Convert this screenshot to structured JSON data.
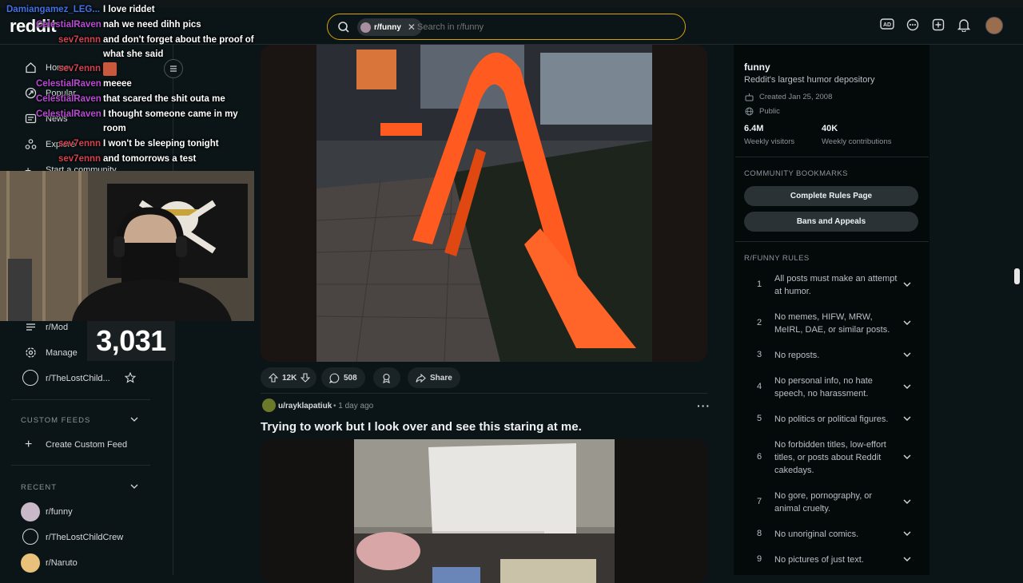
{
  "header": {
    "logo": "reddit",
    "search_chip": "r/funny",
    "search_placeholder": "Search in r/funny"
  },
  "chat": [
    {
      "user": "Damiangamez_LEG...",
      "msg": "I love riddet",
      "color": "dam"
    },
    {
      "user": "CelestialRaven",
      "msg": "nah we need dihh pics",
      "color": "cel"
    },
    {
      "user": "sev7ennn",
      "msg": "and don't forget about the proof of what she said",
      "color": "sev"
    },
    {
      "user": "sev7ennn",
      "msg": "",
      "color": "sev"
    },
    {
      "user": "CelestialRaven",
      "msg": "meeee",
      "color": "cel"
    },
    {
      "user": "CelestialRaven",
      "msg": "that scared the shit outa me",
      "color": "cel"
    },
    {
      "user": "CelestialRaven",
      "msg": "I thought someone came in my room",
      "color": "cel"
    },
    {
      "user": "sev7ennn",
      "msg": "I won't be sleeping tonight",
      "color": "sev"
    },
    {
      "user": "sev7ennn",
      "msg": "and tomorrows a test",
      "color": "sev"
    }
  ],
  "leftnav": {
    "home": "Home",
    "popular": "Popular",
    "news": "News",
    "explore": "Explore",
    "start_community": "Start a community",
    "mod": "r/Mod",
    "manage": "Manage",
    "lostchild": "r/TheLostChild...",
    "custom_feeds": "CUSTOM FEEDS",
    "create_custom_feed": "Create Custom Feed",
    "recent": "RECENT",
    "recent_items": [
      "r/funny",
      "r/TheLostChildCrew",
      "r/Naruto"
    ]
  },
  "counter": "3,031",
  "post1": {
    "upvotes": "12K",
    "comments": "508",
    "share": "Share"
  },
  "post2": {
    "author": "u/rayklapatiuk",
    "time": "• 1 day ago",
    "title": "Trying to work but I look over and see this staring at me."
  },
  "sidebar": {
    "name": "funny",
    "description": "Reddit's largest humor depository",
    "created": "Created Jan 25, 2008",
    "visibility": "Public",
    "visitors_value": "6.4M",
    "visitors_label": "Weekly visitors",
    "contrib_value": "40K",
    "contrib_label": "Weekly contributions",
    "bookmarks_title": "COMMUNITY BOOKMARKS",
    "bookmark1": "Complete Rules Page",
    "bookmark2": "Bans and Appeals",
    "rules_title": "R/FUNNY RULES",
    "rules": [
      {
        "n": "1",
        "text": "All posts must make an attempt at humor."
      },
      {
        "n": "2",
        "text": "No memes, HIFW, MRW, MeIRL, DAE, or similar posts."
      },
      {
        "n": "3",
        "text": "No reposts."
      },
      {
        "n": "4",
        "text": "No personal info, no hate speech, no harassment."
      },
      {
        "n": "5",
        "text": "No politics or political figures."
      },
      {
        "n": "6",
        "text": "No forbidden titles, low-effort titles, or posts about Reddit cakedays."
      },
      {
        "n": "7",
        "text": "No gore, pornography, or animal cruelty."
      },
      {
        "n": "8",
        "text": "No unoriginal comics."
      },
      {
        "n": "9",
        "text": "No pictures of just text."
      }
    ]
  },
  "colors": {
    "accent": "#d6a500",
    "chat_celestial": "#b94ad4",
    "chat_sev": "#d4424f",
    "chat_damian": "#3e72e8",
    "bench": "#ff5a1f"
  }
}
